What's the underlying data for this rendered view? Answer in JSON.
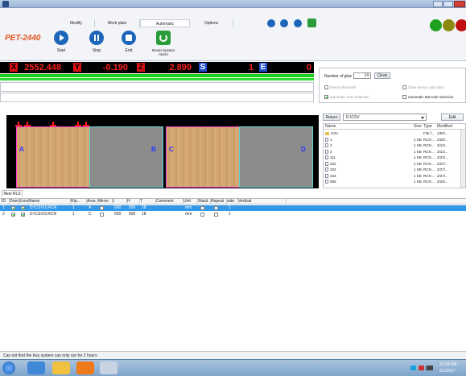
{
  "window": {
    "title_icon": "app-icon"
  },
  "tabs": [
    "Modify",
    "Work plain",
    "Automatic",
    "Options"
  ],
  "app_name": "PET-2440",
  "ribbon_buttons": [
    {
      "label": "Start",
      "icon": "play-icon"
    },
    {
      "label": "Stop",
      "icon": "pause-icon"
    },
    {
      "label": "End",
      "icon": "stop-icon"
    },
    {
      "label": "Reset System Alarm",
      "icon": "reset-icon"
    }
  ],
  "coords": {
    "x_label": "X",
    "x": "2552.448",
    "y_label": "Y",
    "y": "-0.190",
    "z_label": "Z",
    "z": "2.899",
    "s_label": "S",
    "s": "1",
    "e_label": "E",
    "e": "0"
  },
  "right_panel": {
    "glue_label": "Number of glue",
    "glue_value": "14",
    "clean_label": "Clean",
    "bench_photocell": "bench photocell",
    "zone_sensor": "Zone sensor auto door",
    "auto_area": "automatic area selection",
    "auto_barcode": "automatic Barcode selection"
  },
  "zones": [
    "A",
    "B",
    "C",
    "D"
  ],
  "file_browser": {
    "return_label": "Return",
    "path": "D:\\CSV",
    "edit_label": "Edit",
    "headers": [
      "Name",
      "Size",
      "Type",
      "Modified"
    ],
    "rows": [
      {
        "name": "CSV",
        "size": "",
        "type": "File f...",
        "modified": "1/5/2...",
        "folder": true
      },
      {
        "name": "1",
        "size": "1 KB",
        "type": "RCN ...",
        "modified": "2/20/...",
        "folder": false
      },
      {
        "name": "2",
        "size": "1 KB",
        "type": "RCN ...",
        "modified": "3/1/2...",
        "folder": false
      },
      {
        "name": "3",
        "size": "1 KB",
        "type": "RCN ...",
        "modified": "3/1/2...",
        "folder": false
      },
      {
        "name": "111",
        "size": "1 KB",
        "type": "RCN ...",
        "modified": "2/23/...",
        "folder": false
      },
      {
        "name": "222",
        "size": "1 KB",
        "type": "RCN ...",
        "modified": "2/27/...",
        "folder": false
      },
      {
        "name": "333",
        "size": "1 KB",
        "type": "RCN ...",
        "modified": "2/27/...",
        "folder": false
      },
      {
        "name": "444",
        "size": "1 KB",
        "type": "RCN ...",
        "modified": "2/27/...",
        "folder": false
      },
      {
        "name": "555",
        "size": "1 KB",
        "type": "RCN ...",
        "modified": "2/24/...",
        "folder": false
      }
    ]
  },
  "table": {
    "tab_label": "New RLS",
    "headers": [
      "ID",
      "Drav",
      "Exce",
      "Name",
      "Rip...",
      "Area",
      "Mirror",
      "L",
      "H",
      "T",
      "Comment",
      "Unit",
      "Stack",
      "Repeat",
      "side",
      "Vertical"
    ],
    "rows": [
      {
        "id": "1",
        "name": "D:\\CSV\\1.RCN",
        "rip": "1",
        "area": "A",
        "l": "600",
        "h": "500",
        "t": "18",
        "unit": "mm",
        "side": "1",
        "selected": true
      },
      {
        "id": "2",
        "name": "D:\\CSV\\3.RCN",
        "rip": "1",
        "area": "C",
        "l": "600",
        "h": "500",
        "t": "18",
        "unit": "mm",
        "side": "1",
        "selected": false
      }
    ]
  },
  "status": "Can not find the Key system can only run for 2 hours",
  "clock": {
    "time": "12:59 PM",
    "date": "3/1/2017"
  },
  "colors": {
    "accent": "#1c65b8",
    "green": "#1ea11e",
    "olive": "#8a8a10",
    "red": "#c01010"
  }
}
